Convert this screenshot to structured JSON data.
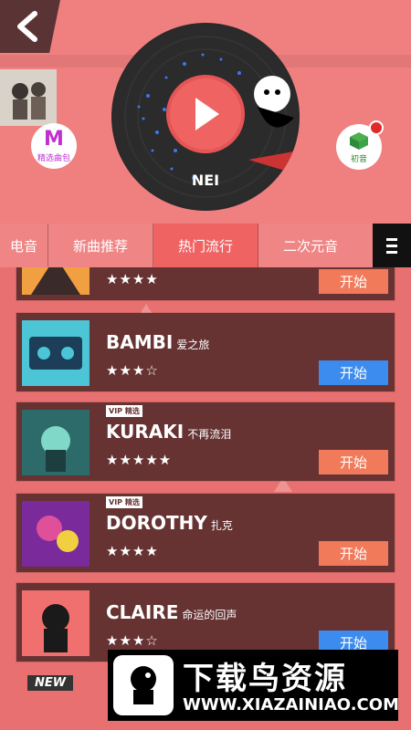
{
  "header": {
    "back_icon": "chevron-left-icon",
    "avatar_icon": "avatar-image",
    "left_badge": {
      "letter": "M",
      "label": "精选曲包"
    },
    "right_badge": {
      "icon": "gift-box-icon",
      "label": "初音"
    },
    "disc": {
      "title": "NEI",
      "play_icon": "play-icon"
    }
  },
  "tabs": [
    {
      "label": "电音"
    },
    {
      "label": "新曲推荐"
    },
    {
      "label": "热门流行",
      "active": true
    },
    {
      "label": "二次元音"
    }
  ],
  "menu_icon": "hamburger-menu-icon",
  "songs": [
    {
      "title": "",
      "subtitle": "",
      "stars": "★★★★",
      "vip": "",
      "button": "开始",
      "button_color": "#f07a5a"
    },
    {
      "title": "BAMBI",
      "subtitle": "爱之旅",
      "stars": "★★★☆",
      "vip": "",
      "button": "开始",
      "button_color": "#3c8cf0"
    },
    {
      "title": "KURAKI",
      "subtitle": "不再流泪",
      "stars": "★★★★★",
      "vip": "VIP 精选",
      "button": "开始",
      "button_color": "#f07a5a"
    },
    {
      "title": "DOROTHY",
      "subtitle": "扎克",
      "stars": "★★★★",
      "vip": "VIP 精选",
      "button": "开始",
      "button_color": "#f07a5a"
    },
    {
      "title": "CLAIRE",
      "subtitle": "命运的回声",
      "stars": "★★★☆",
      "vip": "",
      "button": "开始",
      "button_color": "#3c8cf0"
    }
  ],
  "new_tag": "NEW",
  "watermark": {
    "title": "下载鸟资源",
    "url": "WWW.XIAZAINIAO.COM"
  },
  "colors": {
    "accent": "#f06363",
    "card": "#663232",
    "orange": "#f07a5a",
    "blue": "#3c8cf0"
  }
}
